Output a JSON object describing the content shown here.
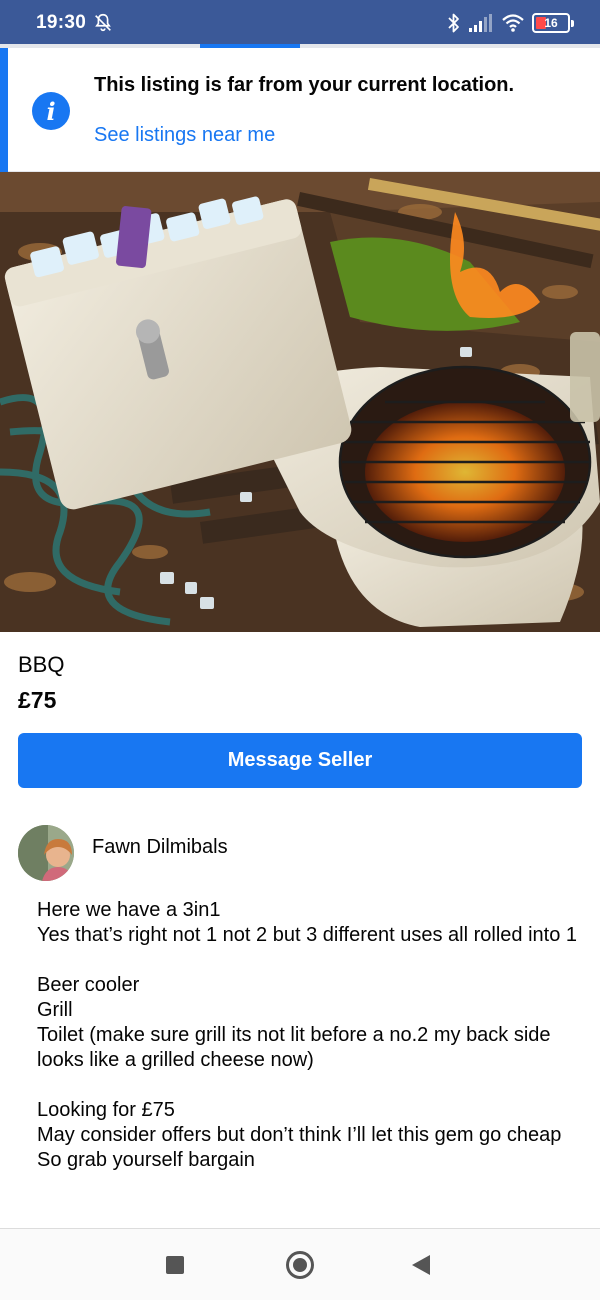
{
  "status_bar": {
    "time": "19:30",
    "left_icon": "notifications-off-icon",
    "right_icons": [
      "bluetooth-icon",
      "cellular-signal-icon",
      "wifi-icon"
    ],
    "battery_level": "16",
    "background_color": "#3b5998"
  },
  "notice": {
    "icon": "info-icon",
    "title": "This listing is far from your current location.",
    "link": "See listings near me"
  },
  "listing": {
    "photo": "listing-photo",
    "title": "BBQ",
    "price": "£75",
    "message_button": "Message Seller"
  },
  "seller": {
    "name": "Fawn Dilmibals"
  },
  "description": {
    "para1": [
      "Here we have a 3in1",
      "Yes that’s right not 1 not 2 but 3 different uses all rolled into 1"
    ],
    "para2": [
      "Beer cooler",
      "Grill",
      "Toilet (make sure grill its not lit before a no.2 my back side looks like a grilled cheese now)"
    ],
    "para3": [
      "Looking for £75",
      "May consider offers but don’t think I’ll let this gem go cheap",
      "So grab yourself bargain"
    ]
  },
  "nav_bar": {
    "items": [
      "recents-square-icon",
      "home-circle-icon",
      "back-triangle-icon"
    ]
  },
  "colors": {
    "accent": "#1877f2",
    "text": "#050505"
  }
}
